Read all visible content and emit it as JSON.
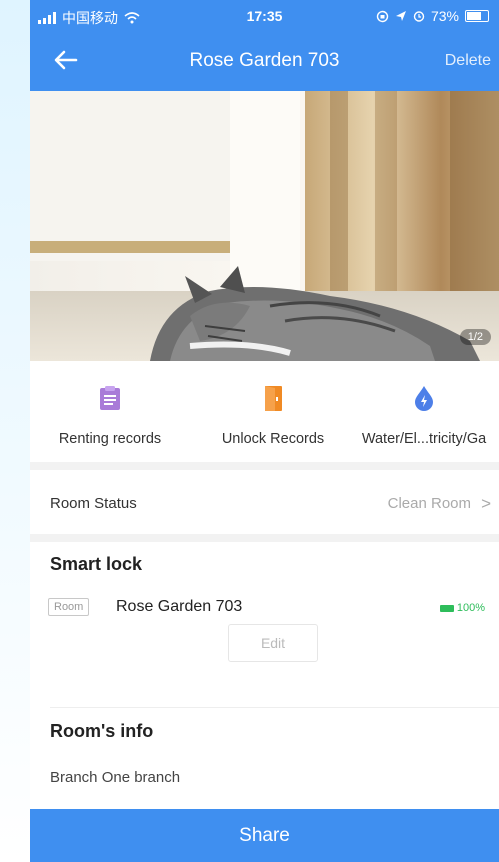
{
  "status_bar": {
    "carrier": "中国移动",
    "time": "17:35",
    "battery": "73%"
  },
  "header": {
    "title": "Rose Garden 703",
    "delete_label": "Delete"
  },
  "photo": {
    "counter": "1/2"
  },
  "actions": [
    {
      "label": "Renting records",
      "icon": "clipboard-icon",
      "color": "#a97bd8"
    },
    {
      "label": "Unlock Records",
      "icon": "door-icon",
      "color": "#f08a24"
    },
    {
      "label": "Water/El...tricity/Ga",
      "icon": "water-drop-icon",
      "color": "#4d7fe8"
    }
  ],
  "room_status": {
    "label": "Room Status",
    "value": "Clean Room",
    "chevron": ">"
  },
  "smart_lock": {
    "title": "Smart lock",
    "tag": "Room",
    "room_name": "Rose Garden 703",
    "battery": "100%",
    "edit_label": "Edit"
  },
  "rooms_info": {
    "title": "Room's info",
    "branch": "Branch  One branch"
  },
  "footer": {
    "share_label": "Share"
  },
  "colors": {
    "accent": "#3f8ff0",
    "battery_green": "#2ebd5b"
  }
}
